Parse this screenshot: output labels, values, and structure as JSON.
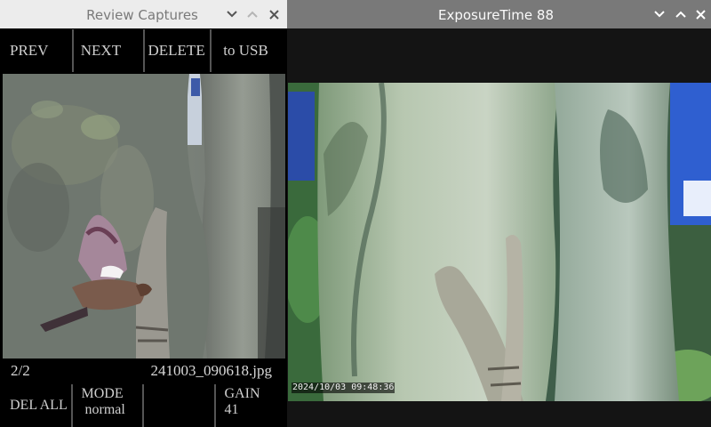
{
  "review_window": {
    "title": "Review Captures",
    "top_buttons": {
      "prev": "PREV",
      "next": "NEXT",
      "delete": "DELETE",
      "to_usb": "to USB"
    },
    "image_index": "2/2",
    "filename": "241003_090618.jpg",
    "bottom_buttons": {
      "del_all": "DEL ALL",
      "mode_label": "MODE",
      "mode_value": "normal",
      "blank": "",
      "gain_label": "GAIN",
      "gain_value": "41"
    }
  },
  "exposure_window": {
    "title": "ExposureTime 88",
    "timestamp": "2024/10/03 09:48:36"
  },
  "colors": {
    "titlebar_active": "#797979",
    "titlebar_inactive": "#ececec",
    "button_bg": "#000000",
    "button_text": "#cfcfcf"
  }
}
